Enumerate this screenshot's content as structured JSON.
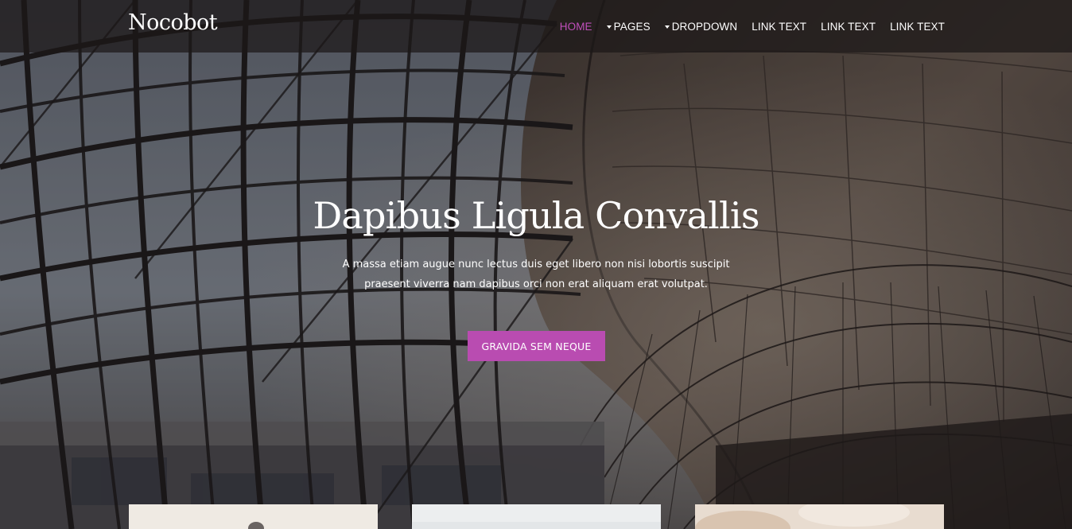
{
  "brand": "Nocobot",
  "nav": {
    "items": [
      {
        "label": "HOME",
        "active": true,
        "dropdown": false
      },
      {
        "label": "PAGES",
        "active": false,
        "dropdown": true
      },
      {
        "label": "DROPDOWN",
        "active": false,
        "dropdown": true
      },
      {
        "label": "LINK TEXT",
        "active": false,
        "dropdown": false
      },
      {
        "label": "LINK TEXT",
        "active": false,
        "dropdown": false
      },
      {
        "label": "LINK TEXT",
        "active": false,
        "dropdown": false
      }
    ]
  },
  "hero": {
    "title": "Dapibus Ligula Convallis",
    "subtitle_line1": "A massa etiam augue nunc lectus duis eget libero non nisi lobortis suscipit",
    "subtitle_line2": "praesent viverra nam dapibus orci non erat aliquam erat volutpat.",
    "button_label": "GRAVIDA SEM NEQUE"
  },
  "colors": {
    "accent": "#b94cb1",
    "active_nav": "#c04fbb",
    "navbar_bg": "#1c1818",
    "text": "#ffffff"
  },
  "icons": {
    "dropdown_caret": "caret-down-icon"
  }
}
